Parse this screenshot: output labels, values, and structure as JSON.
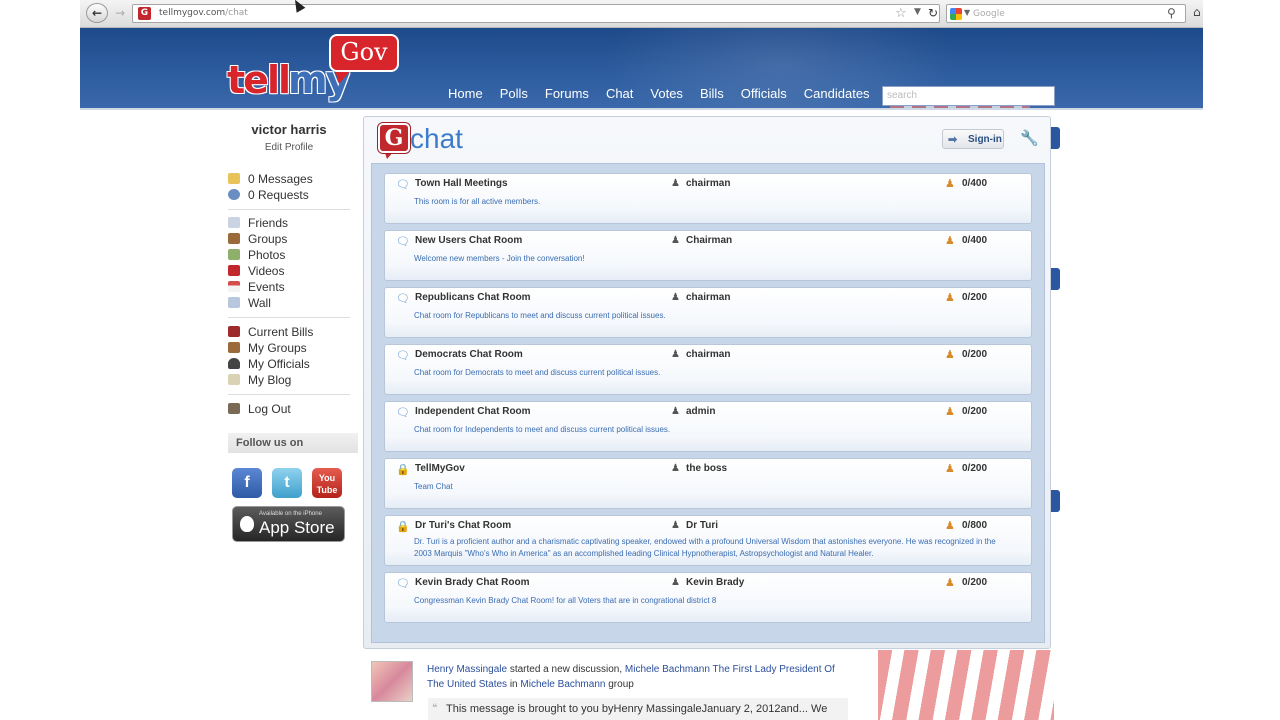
{
  "browser": {
    "url_domain": "tellmygov.com",
    "url_path": "/chat",
    "search_placeholder": "Google"
  },
  "site": {
    "logo_tell": "tell",
    "logo_my": "my",
    "logo_gov": "Gov",
    "nav": [
      "Home",
      "Polls",
      "Forums",
      "Chat",
      "Votes",
      "Bills",
      "Officials",
      "Candidates"
    ],
    "search_placeholder": "search"
  },
  "sidebar": {
    "user_name": "victor harris",
    "edit_profile": "Edit Profile",
    "group1": [
      "0 Messages",
      "0 Requests"
    ],
    "group2": [
      "Friends",
      "Groups",
      "Photos",
      "Videos",
      "Events",
      "Wall"
    ],
    "group3": [
      "Current Bills",
      "My Groups",
      "My Officials",
      "My Blog"
    ],
    "logout": "Log Out",
    "follow_us": "Follow us on",
    "appstore_small": "Available on the iPhone",
    "appstore_big": "App Store"
  },
  "chat": {
    "logo_g": "G",
    "logo_text": "chat",
    "signin_label": "Sign-in",
    "rooms": [
      {
        "name": "Town Hall  Meetings",
        "desc": "This room is for all active members.",
        "owner": "chairman",
        "count": "0/400",
        "locked": false
      },
      {
        "name": "New Users Chat Room",
        "desc": "Welcome new members -  Join the conversation!",
        "owner": "Chairman",
        "count": "0/400",
        "locked": false
      },
      {
        "name": "Republicans Chat Room",
        "desc": "Chat room for Republicans to meet and discuss current political issues.",
        "owner": "chairman",
        "count": "0/200",
        "locked": false
      },
      {
        "name": "Democrats Chat Room",
        "desc": "Chat room for Democrats to meet and discuss current political issues.",
        "owner": "chairman",
        "count": "0/200",
        "locked": false
      },
      {
        "name": "Independent Chat Room",
        "desc": "Chat room for Independents to meet and discuss current political issues.",
        "owner": "admin",
        "count": "0/200",
        "locked": false
      },
      {
        "name": "TellMyGov",
        "desc": "Team Chat",
        "owner": "the boss",
        "count": "0/200",
        "locked": true
      },
      {
        "name": "Dr Turi's Chat Room",
        "desc": "Dr. Turi is a proficient author and a charismatic captivating speaker, endowed with a profound Universal Wisdom that astonishes everyone. He was recognized in the 2003 Marquis \"Who's Who in America\" as an accomplished leading Clinical Hypnotherapist, Astropsychologist and Natural Healer.",
        "owner": "Dr Turi",
        "count": "0/800",
        "locked": true
      },
      {
        "name": "Kevin Brady Chat Room",
        "desc": "Congressman Kevin Brady Chat Room! for all Voters that are in congrational district 8",
        "owner": "Kevin Brady",
        "count": "0/200",
        "locked": false
      }
    ]
  },
  "activity": {
    "user": "Henry Massingale",
    "verb": "started a new discussion,",
    "topic": "Michele Bachmann The First Lady President Of The United States",
    "in_text": "in",
    "group": "Michele Bachmann",
    "group_suffix": "group",
    "message": "This message is brought to you byHenry MassingaleJanuary 2, 2012and... We"
  }
}
